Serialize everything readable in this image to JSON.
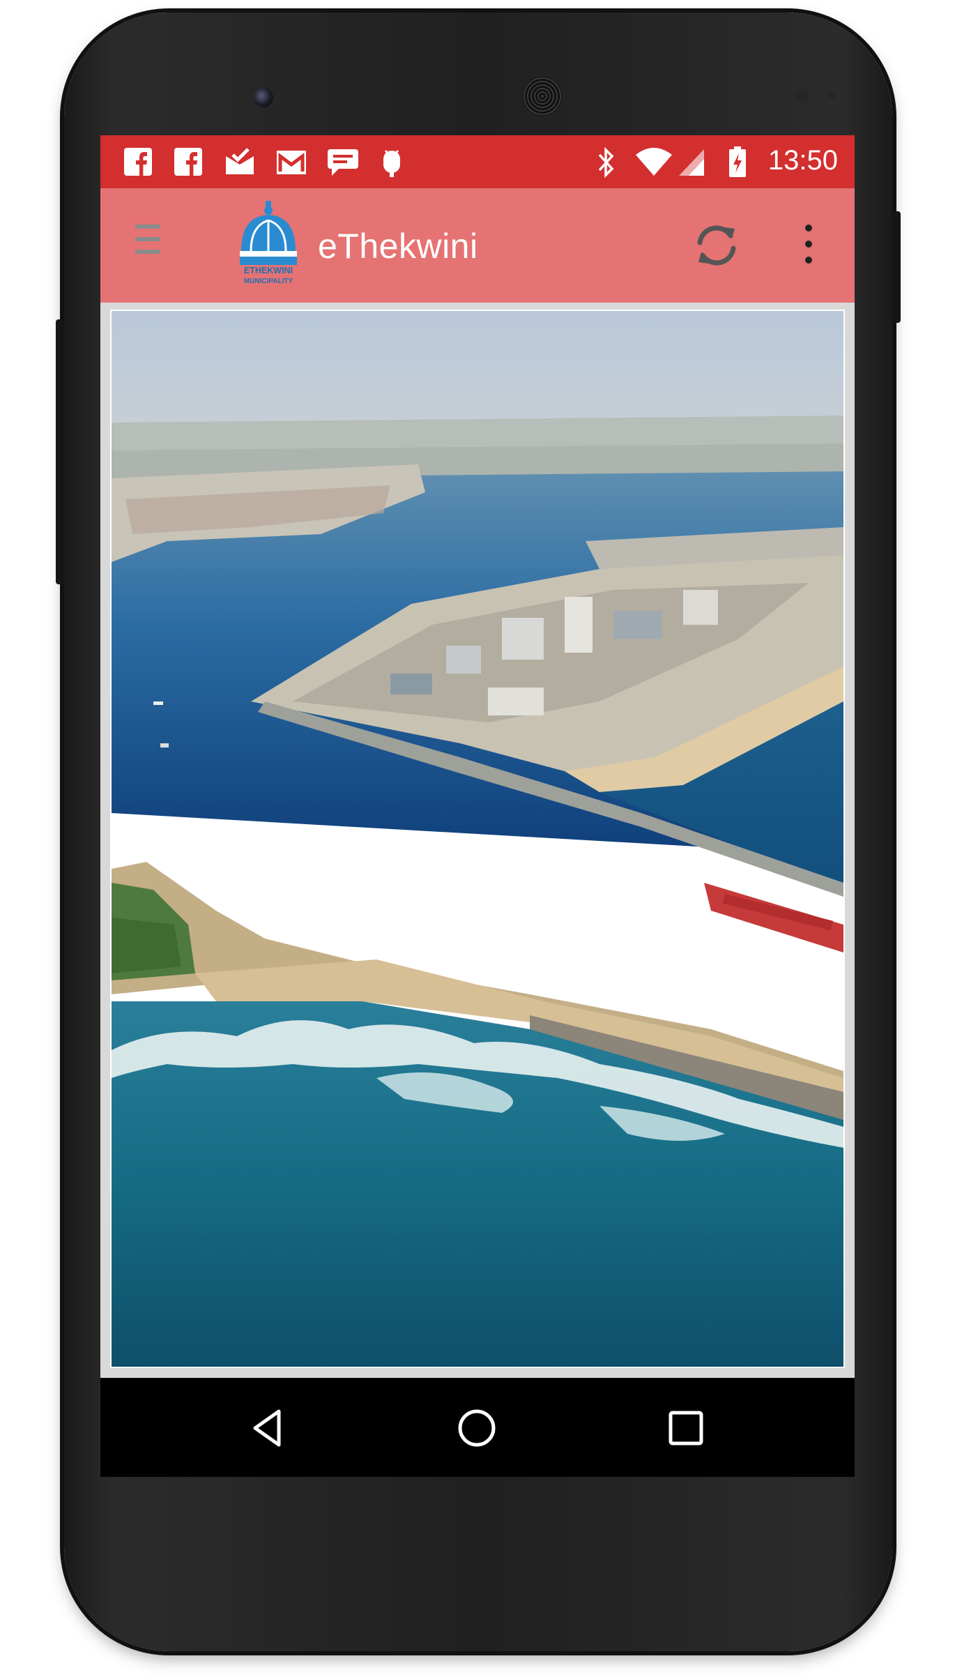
{
  "status_bar": {
    "time": "13:50",
    "left_icons": [
      "facebook-icon",
      "facebook-icon",
      "mail-check-icon",
      "gmail-icon",
      "chat-bubble-icon",
      "android-debug-icon"
    ],
    "right_icons": [
      "bluetooth-icon",
      "wifi-icon",
      "signal-icon",
      "battery-charging-icon"
    ],
    "color": "#d32f2f"
  },
  "toolbar": {
    "title": "eThekwini",
    "logo_text_line1": "ETHEKWINI",
    "logo_text_line2": "MUNICIPALITY",
    "color": "#e57373",
    "actions": [
      "refresh-icon",
      "overflow-menu-icon"
    ]
  },
  "content": {
    "image": "aerial-harbour-photo"
  },
  "nav_bar": {
    "buttons": [
      "back-icon",
      "home-icon",
      "recents-icon"
    ]
  }
}
